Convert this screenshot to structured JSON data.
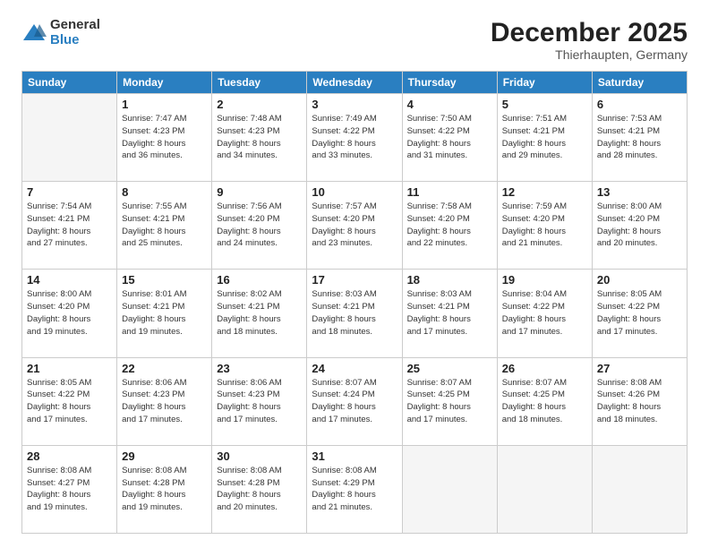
{
  "logo": {
    "general": "General",
    "blue": "Blue"
  },
  "header": {
    "month": "December 2025",
    "location": "Thierhaupten, Germany"
  },
  "weekdays": [
    "Sunday",
    "Monday",
    "Tuesday",
    "Wednesday",
    "Thursday",
    "Friday",
    "Saturday"
  ],
  "weeks": [
    [
      {
        "day": "",
        "info": ""
      },
      {
        "day": "1",
        "info": "Sunrise: 7:47 AM\nSunset: 4:23 PM\nDaylight: 8 hours\nand 36 minutes."
      },
      {
        "day": "2",
        "info": "Sunrise: 7:48 AM\nSunset: 4:23 PM\nDaylight: 8 hours\nand 34 minutes."
      },
      {
        "day": "3",
        "info": "Sunrise: 7:49 AM\nSunset: 4:22 PM\nDaylight: 8 hours\nand 33 minutes."
      },
      {
        "day": "4",
        "info": "Sunrise: 7:50 AM\nSunset: 4:22 PM\nDaylight: 8 hours\nand 31 minutes."
      },
      {
        "day": "5",
        "info": "Sunrise: 7:51 AM\nSunset: 4:21 PM\nDaylight: 8 hours\nand 29 minutes."
      },
      {
        "day": "6",
        "info": "Sunrise: 7:53 AM\nSunset: 4:21 PM\nDaylight: 8 hours\nand 28 minutes."
      }
    ],
    [
      {
        "day": "7",
        "info": "Sunrise: 7:54 AM\nSunset: 4:21 PM\nDaylight: 8 hours\nand 27 minutes."
      },
      {
        "day": "8",
        "info": "Sunrise: 7:55 AM\nSunset: 4:21 PM\nDaylight: 8 hours\nand 25 minutes."
      },
      {
        "day": "9",
        "info": "Sunrise: 7:56 AM\nSunset: 4:20 PM\nDaylight: 8 hours\nand 24 minutes."
      },
      {
        "day": "10",
        "info": "Sunrise: 7:57 AM\nSunset: 4:20 PM\nDaylight: 8 hours\nand 23 minutes."
      },
      {
        "day": "11",
        "info": "Sunrise: 7:58 AM\nSunset: 4:20 PM\nDaylight: 8 hours\nand 22 minutes."
      },
      {
        "day": "12",
        "info": "Sunrise: 7:59 AM\nSunset: 4:20 PM\nDaylight: 8 hours\nand 21 minutes."
      },
      {
        "day": "13",
        "info": "Sunrise: 8:00 AM\nSunset: 4:20 PM\nDaylight: 8 hours\nand 20 minutes."
      }
    ],
    [
      {
        "day": "14",
        "info": "Sunrise: 8:00 AM\nSunset: 4:20 PM\nDaylight: 8 hours\nand 19 minutes."
      },
      {
        "day": "15",
        "info": "Sunrise: 8:01 AM\nSunset: 4:21 PM\nDaylight: 8 hours\nand 19 minutes."
      },
      {
        "day": "16",
        "info": "Sunrise: 8:02 AM\nSunset: 4:21 PM\nDaylight: 8 hours\nand 18 minutes."
      },
      {
        "day": "17",
        "info": "Sunrise: 8:03 AM\nSunset: 4:21 PM\nDaylight: 8 hours\nand 18 minutes."
      },
      {
        "day": "18",
        "info": "Sunrise: 8:03 AM\nSunset: 4:21 PM\nDaylight: 8 hours\nand 17 minutes."
      },
      {
        "day": "19",
        "info": "Sunrise: 8:04 AM\nSunset: 4:22 PM\nDaylight: 8 hours\nand 17 minutes."
      },
      {
        "day": "20",
        "info": "Sunrise: 8:05 AM\nSunset: 4:22 PM\nDaylight: 8 hours\nand 17 minutes."
      }
    ],
    [
      {
        "day": "21",
        "info": "Sunrise: 8:05 AM\nSunset: 4:22 PM\nDaylight: 8 hours\nand 17 minutes."
      },
      {
        "day": "22",
        "info": "Sunrise: 8:06 AM\nSunset: 4:23 PM\nDaylight: 8 hours\nand 17 minutes."
      },
      {
        "day": "23",
        "info": "Sunrise: 8:06 AM\nSunset: 4:23 PM\nDaylight: 8 hours\nand 17 minutes."
      },
      {
        "day": "24",
        "info": "Sunrise: 8:07 AM\nSunset: 4:24 PM\nDaylight: 8 hours\nand 17 minutes."
      },
      {
        "day": "25",
        "info": "Sunrise: 8:07 AM\nSunset: 4:25 PM\nDaylight: 8 hours\nand 17 minutes."
      },
      {
        "day": "26",
        "info": "Sunrise: 8:07 AM\nSunset: 4:25 PM\nDaylight: 8 hours\nand 18 minutes."
      },
      {
        "day": "27",
        "info": "Sunrise: 8:08 AM\nSunset: 4:26 PM\nDaylight: 8 hours\nand 18 minutes."
      }
    ],
    [
      {
        "day": "28",
        "info": "Sunrise: 8:08 AM\nSunset: 4:27 PM\nDaylight: 8 hours\nand 19 minutes."
      },
      {
        "day": "29",
        "info": "Sunrise: 8:08 AM\nSunset: 4:28 PM\nDaylight: 8 hours\nand 19 minutes."
      },
      {
        "day": "30",
        "info": "Sunrise: 8:08 AM\nSunset: 4:28 PM\nDaylight: 8 hours\nand 20 minutes."
      },
      {
        "day": "31",
        "info": "Sunrise: 8:08 AM\nSunset: 4:29 PM\nDaylight: 8 hours\nand 21 minutes."
      },
      {
        "day": "",
        "info": ""
      },
      {
        "day": "",
        "info": ""
      },
      {
        "day": "",
        "info": ""
      }
    ]
  ]
}
